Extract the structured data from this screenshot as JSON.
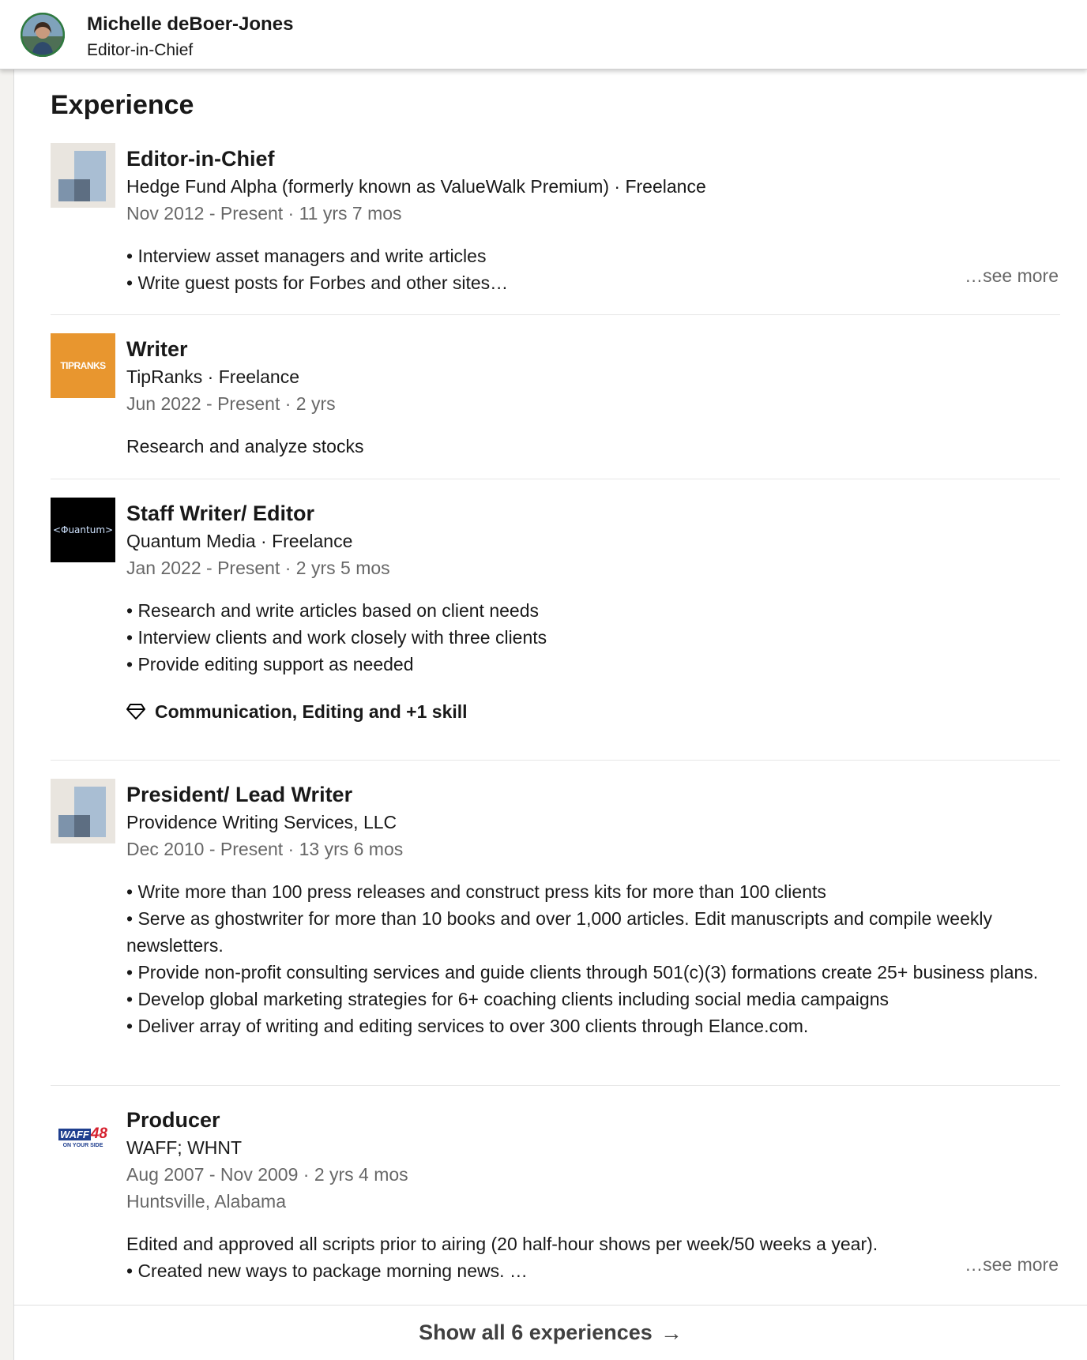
{
  "header": {
    "name": "Michelle deBoer-Jones",
    "headline": "Editor-in-Chief"
  },
  "section": {
    "title": "Experience"
  },
  "experiences": [
    {
      "title": "Editor-in-Chief",
      "company": "Hedge Fund Alpha (formerly known as ValueWalk Premium) · Freelance",
      "dates": "Nov 2012 - Present · 11 yrs 7 mos",
      "description": [
        "• Interview asset managers and write articles",
        "• Write guest posts for Forbes and other sites…"
      ],
      "see_more": "…see more",
      "logo": "placeholder-company-icon"
    },
    {
      "title": "Writer",
      "company": "TipRanks · Freelance",
      "dates": "Jun 2022 - Present · 2 yrs",
      "description": [
        "Research and analyze stocks"
      ],
      "logo_text": "TIPRANKS",
      "logo": "tipranks-logo"
    },
    {
      "title": "Staff Writer/ Editor",
      "company": "Quantum Media · Freelance",
      "dates": "Jan 2022 - Present · 2 yrs 5 mos",
      "description": [
        "• Research and write articles based on client needs",
        "• Interview clients and work closely with three clients",
        "• Provide editing support as needed"
      ],
      "skills": "Communication, Editing and +1 skill",
      "logo_text": "<Φuantum>",
      "logo": "quantum-media-logo"
    },
    {
      "title": "President/ Lead Writer",
      "company": "Providence Writing Services, LLC",
      "dates": "Dec 2010 - Present · 13 yrs 6 mos",
      "description": [
        "• Write more than 100 press releases and construct press kits for more than 100 clients",
        "• Serve as ghostwriter for more than 10 books and over 1,000 articles. Edit manuscripts and compile weekly newsletters.",
        "• Provide non-profit consulting services and guide clients through 501(c)(3) formations create 25+ business plans.",
        "• Develop global marketing strategies for 6+ coaching clients including social media campaigns",
        "• Deliver array of writing and editing services to over 300 clients through Elance.com."
      ],
      "logo": "placeholder-company-icon"
    },
    {
      "title": "Producer",
      "company": "WAFF; WHNT",
      "dates": "Aug 2007 - Nov 2009 · 2 yrs 4 mos",
      "location": "Huntsville, Alabama",
      "description": [
        "Edited and approved all scripts prior to airing (20 half-hour shows per week/50 weeks a year).",
        "• Created new ways to package morning news. …"
      ],
      "see_more": "…see more",
      "logo_text_main": "WAFF",
      "logo_text_num": "48",
      "logo_text_sub": "ON YOUR SIDE",
      "logo": "waff48-logo"
    }
  ],
  "footer": {
    "label": "Show all 6 experiences",
    "icon": "arrow-right-icon"
  },
  "colors": {
    "tipranks_orange": "#e8962f",
    "quantum_bg": "#000000",
    "waff_blue": "#1f3f8f",
    "waff_red": "#d6202e"
  }
}
